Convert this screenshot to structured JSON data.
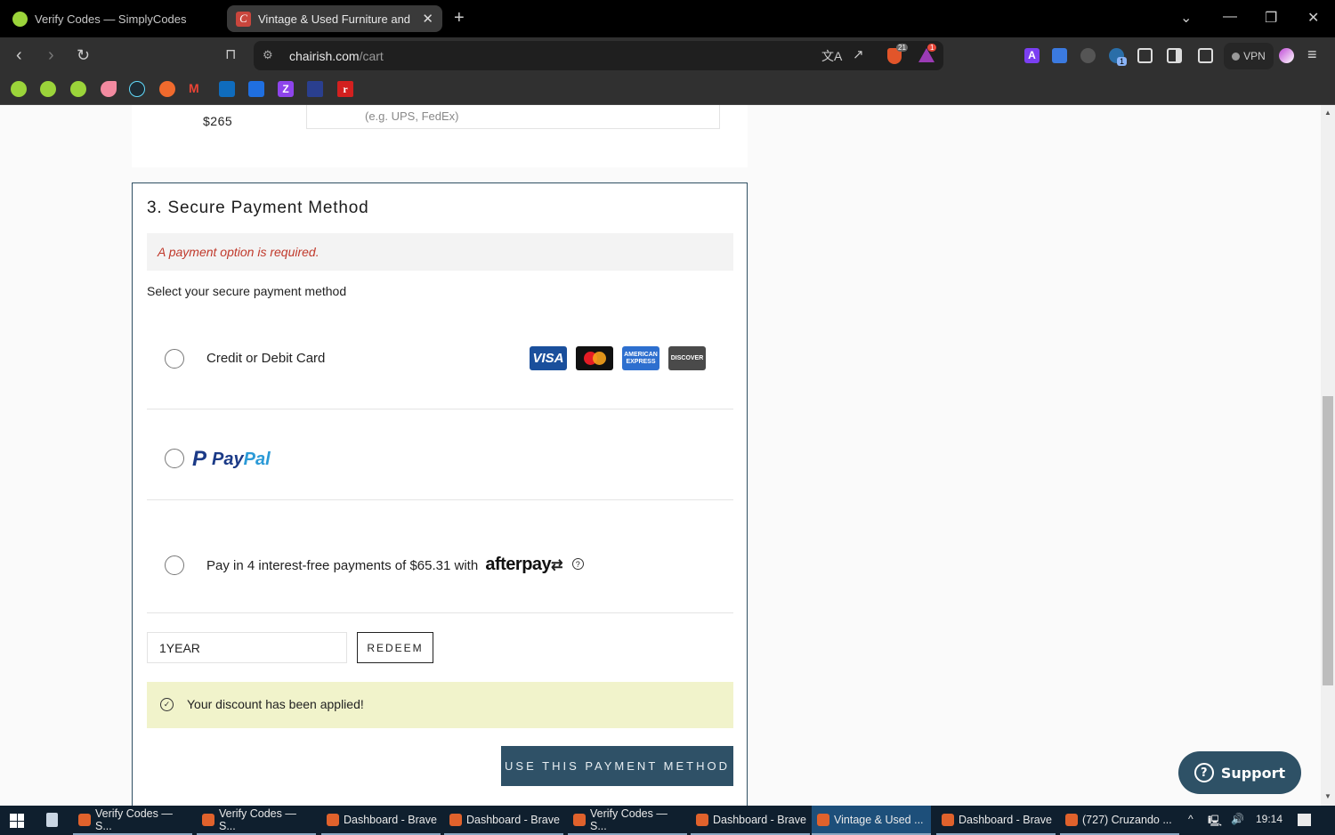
{
  "browser": {
    "tabs": [
      {
        "title": "Verify Codes — SimplyCodes",
        "active": false
      },
      {
        "title": "Vintage & Used Furniture and De",
        "active": true
      }
    ],
    "new_tab_symbol": "+",
    "url_domain": "chairish.com",
    "url_path": "/cart",
    "shields_count": "21",
    "alerts_count": "1",
    "extension_badge": "1",
    "vpn_label": "VPN",
    "bookmarks": [
      "simplycodes-1",
      "simplycodes-2",
      "simplycodes-3",
      "bookmark-pink",
      "react",
      "bookmark-orange",
      "gmail",
      "outlook",
      "zillow",
      "bookmark-z",
      "uk-flag",
      "bookmark-r"
    ]
  },
  "page": {
    "shipping": {
      "price": "$265",
      "carrier_placeholder": "(e.g. UPS, FedEx)"
    },
    "payment": {
      "title": "3. Secure Payment Method",
      "error": "A payment option is required.",
      "select_label": "Select your secure payment method",
      "options": [
        {
          "label": "Credit or Debit Card",
          "selected": false,
          "logos": [
            "VISA",
            "MasterCard",
            "AMERICAN EXPRESS",
            "DISCOVER"
          ]
        },
        {
          "label": "PayPal",
          "selected": false
        },
        {
          "label": "Pay in 4 interest-free payments of $65.31 with",
          "brand": "afterpay",
          "selected": false
        }
      ],
      "paypal_pay": "Pay",
      "paypal_pal": "Pal",
      "afterpay_help": "?",
      "promo_code_value": "1YEAR",
      "redeem_label": "REDEEM",
      "success_message": "Your discount has been applied!",
      "success_icon": "✓",
      "submit_label": "USE THIS PAYMENT METHOD"
    },
    "support_label": "Support",
    "support_icon": "?"
  },
  "taskbar": {
    "items": [
      {
        "label": "Verify Codes — S...",
        "active": false
      },
      {
        "label": "Verify Codes — S...",
        "active": false
      },
      {
        "label": "Dashboard - Brave",
        "active": false
      },
      {
        "label": "Dashboard - Brave",
        "active": false
      },
      {
        "label": "Verify Codes — S...",
        "active": false
      },
      {
        "label": "Dashboard - Brave",
        "active": false
      },
      {
        "label": "Vintage & Used ...",
        "active": true
      },
      {
        "label": "Dashboard - Brave",
        "active": false
      },
      {
        "label": "(727) Cruzando ...",
        "active": false
      }
    ],
    "time": "19:14"
  },
  "scroll_position_fraction": 0.52
}
